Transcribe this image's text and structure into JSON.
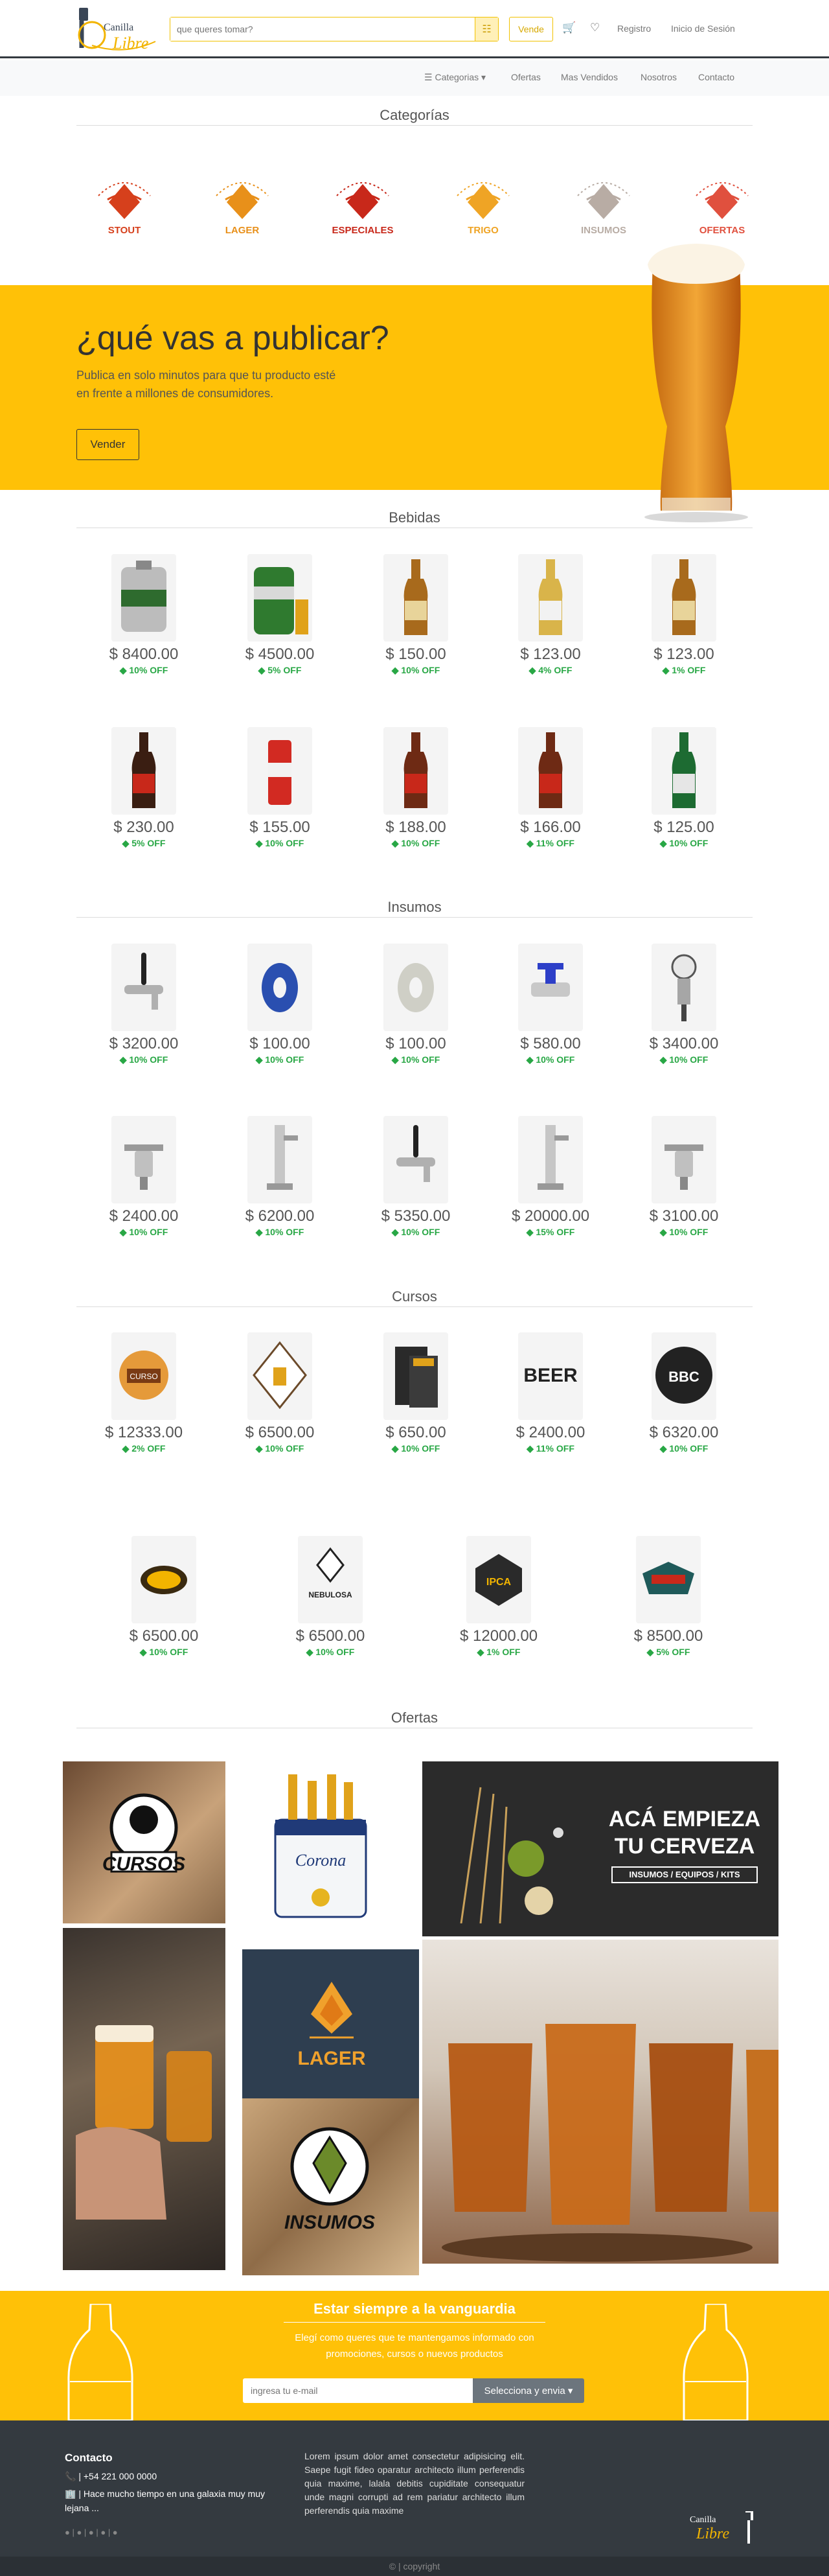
{
  "header": {
    "logo_text": [
      "Canilla",
      "Libre"
    ],
    "search_placeholder": "que queres tomar?",
    "vende_label": "Vende",
    "registro": "Registro",
    "login": "Inicio de Sesión"
  },
  "nav": {
    "categorias": "Categorias",
    "ofertas": "Ofertas",
    "vendidos": "Mas Vendidos",
    "nosotros": "Nosotros",
    "contacto": "Contacto"
  },
  "categorias": {
    "title": "Categorías",
    "items": [
      {
        "label": "STOUT",
        "color": "#d6401c"
      },
      {
        "label": "LAGER",
        "color": "#e8901a"
      },
      {
        "label": "ESPECIALES",
        "color": "#c8281a"
      },
      {
        "label": "TRIGO",
        "color": "#efa425"
      },
      {
        "label": "INSUMOS",
        "color": "#b8aca4"
      },
      {
        "label": "OFERTAS",
        "color": "#e0503e"
      }
    ]
  },
  "banner": {
    "title": "¿qué vas a publicar?",
    "text": "Publica en solo minutos para que tu producto esté en frente a millones de consumidores.",
    "button": "Vender"
  },
  "bebidas": {
    "title": "Bebidas",
    "items": [
      {
        "price": "$ 8400.00",
        "off": "10% OFF",
        "img": "keg"
      },
      {
        "price": "$ 4500.00",
        "off": "5% OFF",
        "img": "keg-green"
      },
      {
        "price": "$ 150.00",
        "off": "10% OFF",
        "img": "bottle-amber"
      },
      {
        "price": "$ 123.00",
        "off": "4% OFF",
        "img": "bottle-clear"
      },
      {
        "price": "$ 123.00",
        "off": "1% OFF",
        "img": "bottle-amber"
      },
      {
        "price": "$ 230.00",
        "off": "5% OFF",
        "img": "bottle-dark"
      },
      {
        "price": "$ 155.00",
        "off": "10% OFF",
        "img": "can-red"
      },
      {
        "price": "$ 188.00",
        "off": "10% OFF",
        "img": "bottle-red"
      },
      {
        "price": "$ 166.00",
        "off": "11% OFF",
        "img": "bottle-red"
      },
      {
        "price": "$ 125.00",
        "off": "10% OFF",
        "img": "bottle-green"
      }
    ]
  },
  "insumos": {
    "title": "Insumos",
    "items": [
      {
        "price": "$ 3200.00",
        "off": "10% OFF",
        "img": "tap"
      },
      {
        "price": "$ 100.00",
        "off": "10% OFF",
        "img": "hose-blue"
      },
      {
        "price": "$ 100.00",
        "off": "10% OFF",
        "img": "hose-clear"
      },
      {
        "price": "$ 580.00",
        "off": "10% OFF",
        "img": "valve"
      },
      {
        "price": "$ 3400.00",
        "off": "10% OFF",
        "img": "regulator"
      },
      {
        "price": "$ 2400.00",
        "off": "10% OFF",
        "img": "coupler"
      },
      {
        "price": "$ 6200.00",
        "off": "10% OFF",
        "img": "tower"
      },
      {
        "price": "$ 5350.00",
        "off": "10% OFF",
        "img": "tap"
      },
      {
        "price": "$ 20000.00",
        "off": "15% OFF",
        "img": "tower"
      },
      {
        "price": "$ 3100.00",
        "off": "10% OFF",
        "img": "coupler"
      }
    ]
  },
  "cursos": {
    "title": "Cursos",
    "items": [
      {
        "price": "$ 12333.00",
        "off": "2% OFF",
        "img": "curso-badge"
      },
      {
        "price": "$ 6500.00",
        "off": "10% OFF",
        "img": "curso-diamond"
      },
      {
        "price": "$ 650.00",
        "off": "10% OFF",
        "img": "curso-book"
      },
      {
        "price": "$ 2400.00",
        "off": "11% OFF",
        "img": "curso-beer"
      },
      {
        "price": "$ 6320.00",
        "off": "10% OFF",
        "img": "curso-bbc"
      },
      {
        "price": "$ 6500.00",
        "off": "10% OFF",
        "img": "curso-yellow"
      },
      {
        "price": "$ 6500.00",
        "off": "10% OFF",
        "img": "curso-nebulosa"
      },
      {
        "price": "$ 12000.00",
        "off": "1% OFF",
        "img": "curso-ipca"
      },
      {
        "price": "$ 8500.00",
        "off": "5% OFF",
        "img": "curso-teal"
      }
    ],
    "texts": {
      "curso": "CURSO",
      "beer": "BEER",
      "bbc": "BBC",
      "nebulosa": "NEBULOSA",
      "ipca": "IPCA"
    }
  },
  "ofertas": {
    "title": "Ofertas",
    "cursos": "CURSOS",
    "lager": "LAGER",
    "insumos": "INSUMOS",
    "corona": "Corona",
    "aca1": "ACÁ EMPIEZA",
    "aca2": "TU CERVEZA",
    "aca3": "INSUMOS / EQUIPOS / KITS"
  },
  "newsletter": {
    "title": "Estar siempre a la vanguardia",
    "text": "Elegí como queres que te mantengamos informado con promociones, cursos o nuevos productos",
    "placeholder": "ingresa tu e-mail",
    "button": "Selecciona y envia"
  },
  "footer": {
    "contact_title": "Contacto",
    "phone": "| +54 221 000 0000",
    "address": "| Hace mucho tiempo en una galaxia muy muy lejana ...",
    "lorem": "Lorem ipsum dolor amet consectetur adipisicing elit. Saepe fugit fideo oparatur architecto illum perferendis quia maxime, lalala debitis cupiditate consequatur unde magni corrupti ad rem pariatur architecto illum perferendis quia maxime",
    "copyright": "| copyright"
  },
  "colors": {
    "accent": "#ffc107",
    "dark": "#343a40",
    "green": "#28a745"
  }
}
